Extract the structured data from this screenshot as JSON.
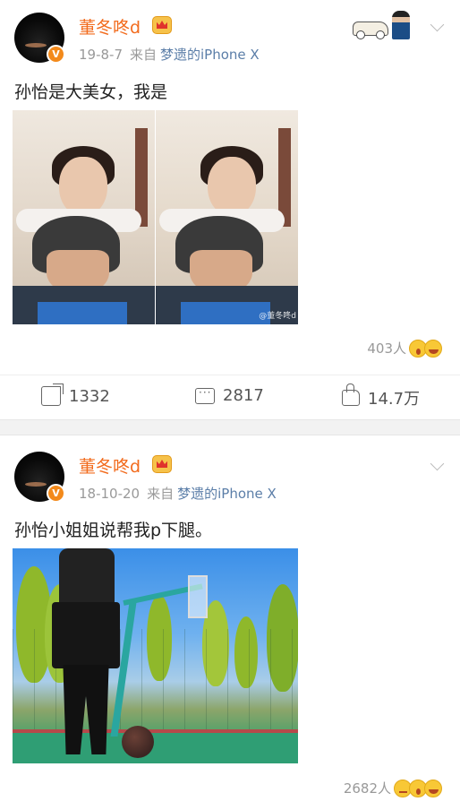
{
  "posts": [
    {
      "username": "董冬咚d",
      "verified_badge": "V",
      "date": "19-8-7",
      "source_prefix": "来自",
      "source_device": "梦遗的iPhone X",
      "text": "孙怡是大美女，我是",
      "photo_watermark": "@董冬咚d",
      "likes_count": "403人",
      "reactions": [
        "wow-emoji",
        "laugh-emoji"
      ],
      "actions": {
        "repost_count": "1332",
        "comment_count": "2817",
        "like_count": "14.7万"
      }
    },
    {
      "username": "董冬咚d",
      "verified_badge": "V",
      "date": "18-10-20",
      "source_prefix": "来自",
      "source_device": "梦遗的iPhone X",
      "text": "孙怡小姐姐说帮我p下腿。",
      "likes_count": "2682人",
      "reactions": [
        "smirk-emoji",
        "wow-emoji",
        "laugh-emoji"
      ]
    }
  ],
  "colors": {
    "username": "#f26b1d",
    "source_link": "#5b7ea8",
    "meta": "#999999",
    "separator": "#f2f2f2"
  }
}
